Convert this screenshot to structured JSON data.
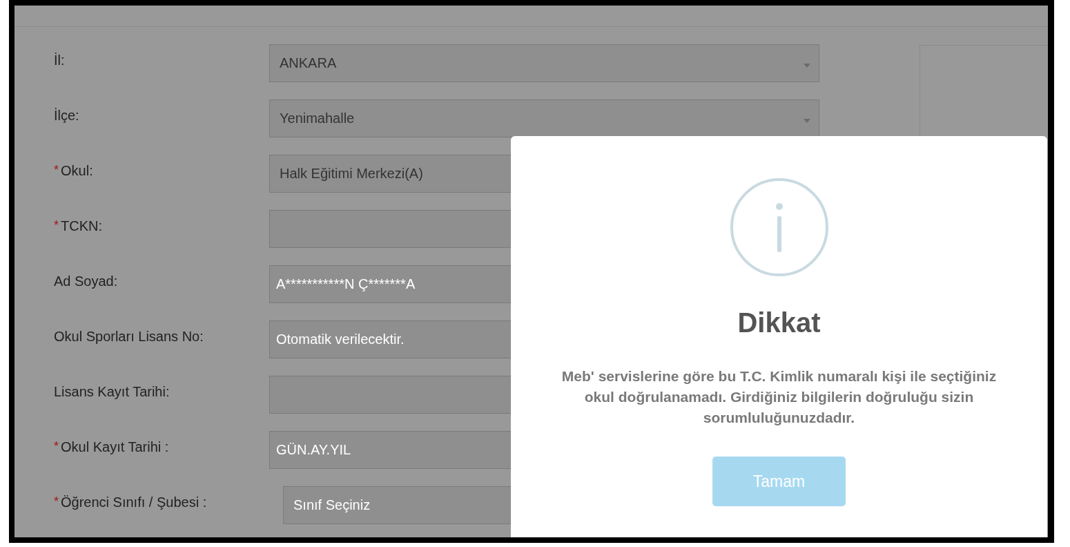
{
  "form": {
    "fields": [
      {
        "label": "İl:",
        "kind": "select",
        "value": "ANKARA"
      },
      {
        "label": "İlçe:",
        "kind": "select",
        "value": "Yenimahalle"
      },
      {
        "label": "Okul:",
        "required_mark": "*",
        "kind": "select",
        "value": "Halk Eğitimi Merkezi(A)"
      },
      {
        "label": "TCKN:",
        "required_mark": "*",
        "kind": "input"
      },
      {
        "label": "Ad Soyad:",
        "kind": "input",
        "placeholder": "A***********N Ç*******A"
      },
      {
        "label": "Okul Sporları Lisans No:",
        "kind": "input",
        "placeholder": "Otomatik verilecektir."
      },
      {
        "label": "Lisans Kayıt Tarihi:",
        "kind": "input"
      },
      {
        "label": "Okul Kayıt Tarihi :",
        "required_mark": "*",
        "kind": "input",
        "placeholder": "GÜN.AY.YIL"
      },
      {
        "label": "Öğrenci Sınıfı / Şubesi :",
        "required_mark": "*",
        "kind": "select",
        "indented": true,
        "placeholder": "Sınıf Seçiniz"
      }
    ]
  },
  "dialog": {
    "title": "Dikkat",
    "message": "Meb' servislerine göre bu T.C. Kimlik numaralı kişi ile seçtiğiniz okul doğrulanamadı. Girdiğiniz bilgilerin doğruluğu sizin sorumluluğunuzdadır.",
    "button": "Tamam"
  }
}
